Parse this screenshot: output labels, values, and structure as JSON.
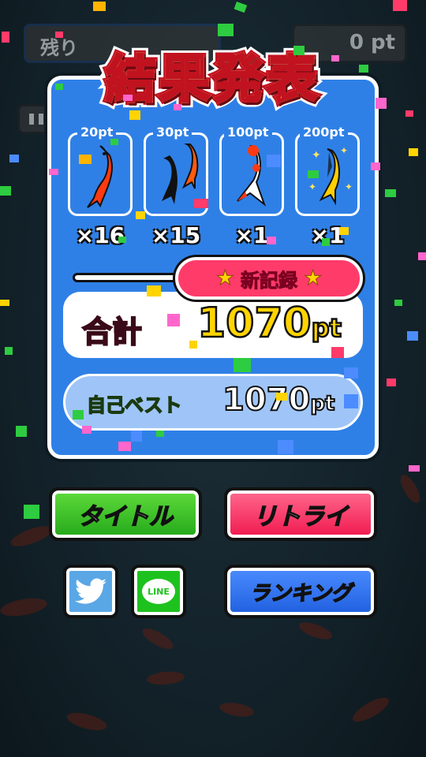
{
  "hud": {
    "remaining_label": "残り",
    "score_display": "0 pt"
  },
  "results": {
    "title": "結果発表",
    "fish": [
      {
        "points": "20pt",
        "count": "×16",
        "kind": "red-goldfish"
      },
      {
        "points": "30pt",
        "count": "×15",
        "kind": "black-and-red-goldfish-pair"
      },
      {
        "points": "100pt",
        "count": "×1",
        "kind": "red-white-goldfish"
      },
      {
        "points": "200pt",
        "count": "×1",
        "kind": "golden-goldfish"
      }
    ],
    "new_record_badge": "新記録",
    "total_label": "合計",
    "total_value": "1070",
    "total_unit": "pt",
    "best_label": "自己ベスト",
    "best_value": "1070",
    "best_unit": "pt"
  },
  "buttons": {
    "title": "タイトル",
    "retry": "リトライ",
    "ranking": "ランキング",
    "twitter_icon": "twitter-bird-icon",
    "line_icon": "line-icon",
    "line_text": "LINE"
  },
  "colors": {
    "panel_blue": "#2f80e6",
    "title_orange": "#ff8a00",
    "record_pink": "#ff3b6a",
    "total_yellow": "#ffd400",
    "title_button_green": "#24a81a",
    "retry_button_pink": "#f0184e",
    "ranking_button_blue": "#1f5fdf"
  }
}
